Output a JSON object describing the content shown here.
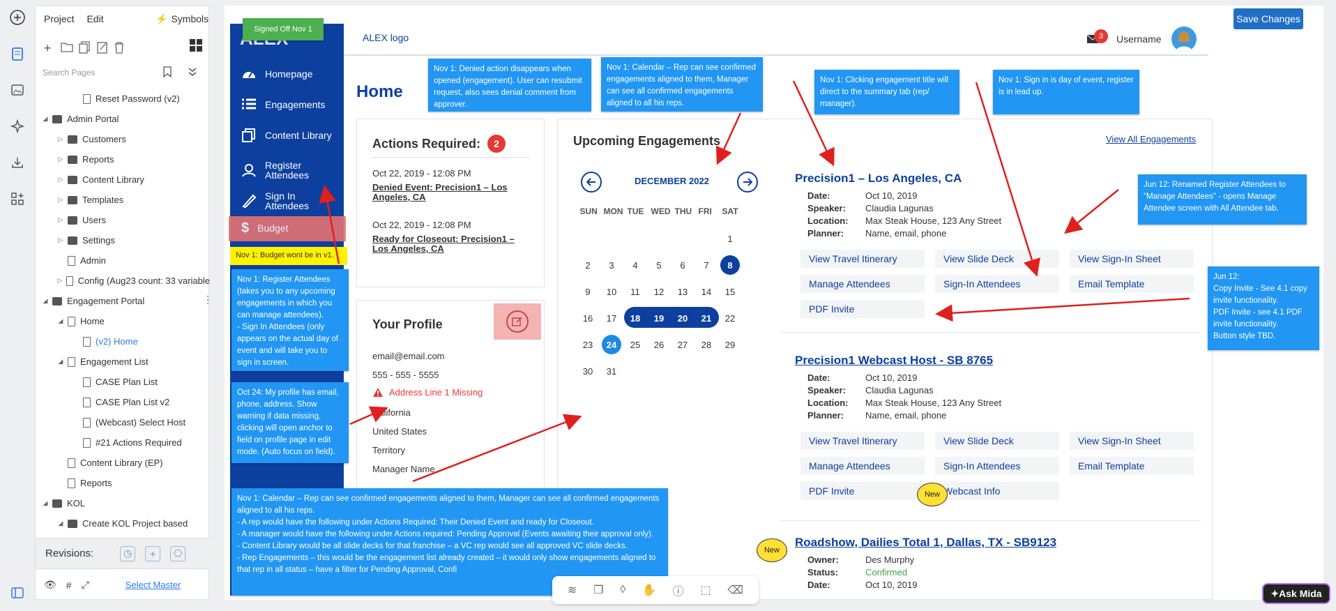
{
  "editor": {
    "menu": {
      "project": "Project",
      "edit": "Edit",
      "symbols": "Symbols"
    },
    "search_placeholder": "Search Pages",
    "tree": [
      {
        "label": "Reset Password (v2)",
        "depth": 3,
        "type": "page",
        "expanded": false,
        "has_children": false
      },
      {
        "label": "Admin Portal",
        "depth": 1,
        "type": "folder",
        "expanded": true,
        "has_children": true
      },
      {
        "label": "Customers",
        "depth": 2,
        "type": "folder",
        "expanded": false,
        "has_children": true
      },
      {
        "label": "Reports",
        "depth": 2,
        "type": "folder",
        "expanded": false,
        "has_children": true
      },
      {
        "label": "Content Library",
        "depth": 2,
        "type": "folder",
        "expanded": false,
        "has_children": true
      },
      {
        "label": "Templates",
        "depth": 2,
        "type": "folder",
        "expanded": false,
        "has_children": true
      },
      {
        "label": "Users",
        "depth": 2,
        "type": "folder",
        "expanded": false,
        "has_children": true
      },
      {
        "label": "Settings",
        "depth": 2,
        "type": "folder",
        "expanded": false,
        "has_children": true
      },
      {
        "label": "Admin",
        "depth": 2,
        "type": "page",
        "expanded": false,
        "has_children": false
      },
      {
        "label": "Config (Aug23 count: 33 variable",
        "depth": 2,
        "type": "page",
        "expanded": false,
        "has_children": true
      },
      {
        "label": "Engagement Portal",
        "depth": 1,
        "type": "folder",
        "expanded": true,
        "has_children": true
      },
      {
        "label": "Home",
        "depth": 2,
        "type": "page",
        "expanded": true,
        "has_children": true
      },
      {
        "label": "(v2) Home",
        "depth": 3,
        "type": "page",
        "expanded": false,
        "has_children": false,
        "selected": true
      },
      {
        "label": "Engagement List",
        "depth": 2,
        "type": "page",
        "expanded": true,
        "has_children": true
      },
      {
        "label": "CASE Plan List",
        "depth": 3,
        "type": "page",
        "expanded": false,
        "has_children": false
      },
      {
        "label": "CASE Plan List v2",
        "depth": 3,
        "type": "page",
        "expanded": false,
        "has_children": false
      },
      {
        "label": "(Webcast) Select Host",
        "depth": 3,
        "type": "page",
        "expanded": false,
        "has_children": false
      },
      {
        "label": "#21 Actions Required",
        "depth": 3,
        "type": "page",
        "expanded": false,
        "has_children": false
      },
      {
        "label": "Content Library (EP)",
        "depth": 2,
        "type": "page",
        "expanded": false,
        "has_children": false
      },
      {
        "label": "Reports",
        "depth": 2,
        "type": "page",
        "expanded": false,
        "has_children": false
      },
      {
        "label": "KOL",
        "depth": 1,
        "type": "folder",
        "expanded": true,
        "has_children": true
      },
      {
        "label": "Create KOL Project based",
        "depth": 2,
        "type": "folder",
        "expanded": true,
        "has_children": true
      }
    ],
    "revisions_label": "Revisions:",
    "select_master": "Select Master",
    "save_changes": "Save Changes",
    "ask_mida": "Ask Mida"
  },
  "app": {
    "logo_text": "ALEX logo",
    "badge_count": "3",
    "username": "Username",
    "nav": [
      {
        "label": "Homepage"
      },
      {
        "label": "Engagements"
      },
      {
        "label": "Content Library"
      },
      {
        "label": "Register Attendees"
      },
      {
        "label": "Sign In Attendees"
      },
      {
        "label": "Budget"
      }
    ],
    "page_title": "Home",
    "actions": {
      "title": "Actions Required:",
      "count": "2",
      "items": [
        {
          "date": "Oct 22, 2019 - 12:08 PM",
          "link": "Denied Event: Precision1 – Los Angeles, CA"
        },
        {
          "date": "Oct 22, 2019 - 12:08 PM",
          "link": "Ready for Closeout: Precision1 – Los Angeles, CA"
        }
      ]
    },
    "profile": {
      "title": "Your Profile",
      "email": "email@email.com",
      "phone": "555 - 555 - 5555",
      "warning": "Address Line 1 Missing",
      "state": "California",
      "country": "United States",
      "territory": "Territory",
      "manager": "Manager Name"
    },
    "upcoming": {
      "title": "Upcoming Engagements",
      "view_all": "View All Engagements",
      "month": "DECEMBER 2022",
      "dow": [
        "SUN",
        "MON",
        "TUE",
        "WED",
        "THU",
        "FRI",
        "SAT"
      ],
      "first_weekday": 6,
      "days_in_month": 31,
      "highlight_days": [
        8,
        18,
        19,
        20,
        21
      ],
      "range_days": [
        18,
        19,
        20,
        21
      ],
      "today": 24
    },
    "labels": {
      "date": "Date:",
      "speaker": "Speaker:",
      "location": "Location:",
      "planner": "Planner:",
      "owner": "Owner:",
      "status": "Status:"
    },
    "engagements": [
      {
        "title": "Precision1 – Los Angeles, CA",
        "date": "Oct 10, 2019",
        "speaker": "Claudia Lagunas",
        "location": "Max Steak House, 123 Any Street",
        "planner": "Name, email, phone",
        "buttons": [
          "View Travel Itinerary",
          "View Slide Deck",
          "View Sign-In Sheet",
          "Manage Attendees",
          "Sign-In Attendees",
          "Email Template",
          "PDF Invite"
        ]
      },
      {
        "title": "Precision1 Webcast Host - SB 8765",
        "date": "Oct 10, 2019",
        "speaker": "Claudia Lagunas",
        "location": "Max Steak House, 123 Any Street",
        "planner": "Name, email, phone",
        "buttons": [
          "View Travel Itinerary",
          "View Slide Deck",
          "View Sign-In Sheet",
          "Manage Attendees",
          "Sign-In Attendees",
          "Email Template",
          "PDF Invite",
          "Webcast Info"
        ]
      },
      {
        "title": "Roadshow, Dailies Total 1, Dallas, TX - SB9123",
        "owner": "Des Murphy",
        "status": "Confirmed",
        "date": "Oct 10, 2019"
      }
    ]
  },
  "annotations": {
    "signed_off": "Signed Off Nov 1",
    "new_badge": "New",
    "budget_note": "Nov 1: Budget wont be in v1.",
    "notes": {
      "denied": "Nov 1: Denied action disappears when opened (engagement). User can resubmit request, also sees denial comment from approver.",
      "calendar_top": "Nov 1: Calendar – Rep can see confirmed engagements aligned to them, Manager can see all confirmed engagements aligned to all his reps.",
      "click_title": "Nov 1: Clicking engagement title will direct to the summary tab (rep/ manager).",
      "signin": "Nov 1: Sign in is day of event, register is in lead up.",
      "renamed": "Jun 12: Renamed Register Attendees to \"Manage Attendees\" - opens Manage Attendee screen with All Attendee tab.",
      "copy_invite": "Jun 12:\nCopy Invite - See 4.1 copy invite functionality.\nPDF Invite - see 4.1 PDF invite functionality.\nButton style TBD.",
      "register": "Nov 1: Register Attendees (takes you to any upcoming engagements in which you can manage attendees).\n- Sign In Attendees (only appears on the actual day of event and will take you to sign in screen.",
      "profile": "Oct 24: My profile has email, phone, address. Show warning if data missing, clicking will open anchor to field on profile page in edit mode. (Auto focus on field).",
      "bottom": "Nov 1: Calendar – Rep can see confirmed engagements aligned to them, Manager can see all confirmed engagements aligned to all his reps.\n- A rep would have the following under Actions Required: Their Denied Event and ready for Closeout.\n- A manager would have the following under Actions required: Pending Approval (Events awaiting their approval only).\n- Content Library would be all slide decks for that franchise – a VC rep would see all approved VC slide decks.\n- Rep Engagements – this would be the engagement list already created – it would only show engagements aligned to that rep in all status – have a filter for Pending Approval, Confi"
    }
  },
  "colors": {
    "navy": "#0c3f9e",
    "note_blue": "#2196f3",
    "warning_red": "#e53935",
    "badge_red": "#e53935",
    "confirmed_green": "#43a047",
    "sign_off_green": "#4caf50"
  }
}
